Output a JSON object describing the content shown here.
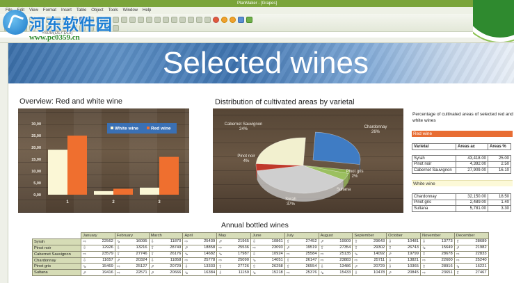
{
  "app": {
    "title": "PlanMaker - [Grapes]",
    "menu": [
      "File",
      "Edit",
      "View",
      "Format",
      "Insert",
      "Table",
      "Object",
      "Tools",
      "Window",
      "Help"
    ],
    "formula": "=SUM(D17:D19)"
  },
  "watermark": {
    "name": "河东软件园",
    "url": "www.pc0359.cn"
  },
  "banner": {
    "title": "Selected wines"
  },
  "overview": {
    "title": "Overview: Red and white wine",
    "chart_data": {
      "type": "bar",
      "categories": [
        "1",
        "2",
        "3"
      ],
      "series": [
        {
          "name": "White wine",
          "values": [
            19.0,
            1.5,
            3.0
          ],
          "color": "#fbf7d6"
        },
        {
          "name": "Red wine",
          "values": [
            25.0,
            2.5,
            16.0
          ],
          "color": "#ef6f2f"
        }
      ],
      "ylim": [
        0,
        30
      ],
      "yticks": [
        "0,00",
        "5,00",
        "10,00",
        "15,00",
        "20,00",
        "25,00",
        "30,00"
      ],
      "legend": "top-right"
    }
  },
  "distribution": {
    "title": "Distribution of cultivated areas by varietal",
    "chart_data": {
      "type": "pie",
      "labels": [
        "Chardonnay",
        "Pinot gris",
        "Sultana",
        "Syrah",
        "Pinot noir",
        "Cabernet Sauvignon"
      ],
      "values": [
        26,
        2,
        4,
        37,
        4,
        24
      ],
      "label_texts": [
        "Chardonnay\n26%",
        "Pinot gris\n2%",
        "Sultana",
        "Syrah\n37%",
        "Pinot noir\n4%",
        "Cabernet Sauvignon\n24%"
      ],
      "colors": [
        "#3f7cc4",
        "#8ab04a",
        "#9bc060",
        "#cfcfcf",
        "#c0392b",
        "#f2f0cf"
      ]
    }
  },
  "percentages": {
    "title": "Percentage of cultivated areas of selected red and white wines",
    "red_label": "Red wine",
    "white_label": "White wine",
    "headers": [
      "Varietal",
      "Areas ac",
      "Areas %"
    ],
    "red_rows": [
      [
        "Syrah",
        "43,418.00",
        "25.00"
      ],
      [
        "Pinot noir",
        "4,392.00",
        "2.50"
      ],
      [
        "Cabernet Sauvignon",
        "27,909.00",
        "16.10"
      ]
    ],
    "white_rows": [
      [
        "Chardonnay",
        "32,150.00",
        "18.50"
      ],
      [
        "Pinot gris",
        "2,489.00",
        "1.40"
      ],
      [
        "Sultana",
        "5,781.00",
        "3.30"
      ]
    ]
  },
  "bottled": {
    "title": "Annual bottled wines",
    "months": [
      "January",
      "February",
      "March",
      "April",
      "May",
      "June",
      "July",
      "August",
      "September",
      "October",
      "November",
      "December"
    ],
    "rows": [
      {
        "name": "Syrah",
        "values": [
          "22562",
          "16095",
          "11870",
          "25439",
          "21965",
          "10861",
          "27452",
          "19909",
          "29643",
          "10481",
          "13773",
          "28689"
        ]
      },
      {
        "name": "Pinot noir",
        "values": [
          "12926",
          "13216",
          "28749",
          "18858",
          "25536",
          "23093",
          "19519",
          "27354",
          "29302",
          "26743",
          "15649",
          "21982"
        ]
      },
      {
        "name": "Cabernet Sauvignon",
        "values": [
          "23579",
          "27746",
          "26176",
          "14682",
          "17987",
          "10924",
          "25584",
          "25135",
          "14092",
          "19799",
          "28678",
          "22833"
        ]
      },
      {
        "name": "Chardonnay",
        "values": [
          "11657",
          "20324",
          "11858",
          "25778",
          "25090",
          "14051",
          "26147",
          "23883",
          "25711",
          "13821",
          "22600",
          "25240"
        ]
      },
      {
        "name": "Pinot gris",
        "values": [
          "15469",
          "25127",
          "20729",
          "13333",
          "27726",
          "26258",
          "26554",
          "13486",
          "20729",
          "10365",
          "28916",
          "16221"
        ]
      },
      {
        "name": "Sultana",
        "values": [
          "19416",
          "22571",
          "20666",
          "16384",
          "11159",
          "15218",
          "25376",
          "15433",
          "10478",
          "20845",
          "23651",
          "27467"
        ]
      }
    ]
  }
}
